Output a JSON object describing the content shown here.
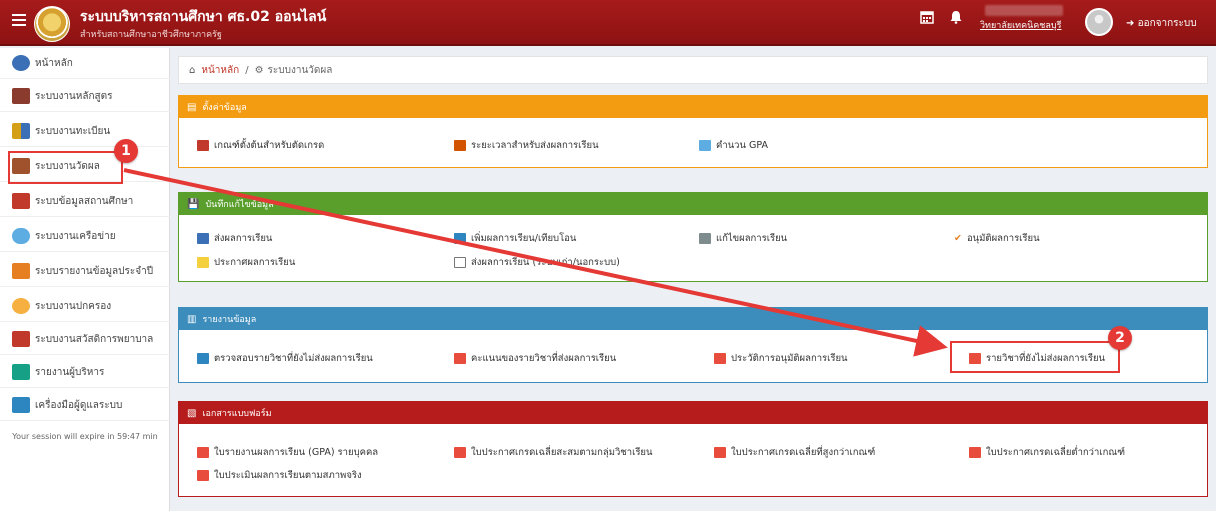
{
  "header": {
    "title": "ระบบบริหารสถานศึกษา ศธ.02 ออนไลน์",
    "subtitle": "สำหรับสถานศึกษาอาชีวศึกษาภาครัฐ",
    "school": "วิทยาลัยเทคนิคชลบุรี",
    "logout_label": "ออกจากระบบ",
    "calendar_icon": "calendar-icon",
    "bell_icon": "bell-icon"
  },
  "sidebar": {
    "items": [
      {
        "label": "หน้าหลัก",
        "icon": "globe-icon",
        "color": "#3b6fb6"
      },
      {
        "label": "ระบบงานหลักสูตร",
        "icon": "book-icon",
        "color": "#8b3a2e"
      },
      {
        "label": "ระบบงานทะเบียน",
        "icon": "people-icon",
        "color": "#d4a017"
      },
      {
        "label": "ระบบงานวัดผล",
        "icon": "calculator-icon",
        "color": "#a0522d"
      },
      {
        "label": "ระบบข้อมูลสถานศึกษา",
        "icon": "school-icon",
        "color": "#c0392b"
      },
      {
        "label": "ระบบงานเครือข่าย",
        "icon": "cloud-icon",
        "color": "#5dade2"
      },
      {
        "label": "ระบบรายงานข้อมูลประจำปี",
        "icon": "report-icon",
        "color": "#e67e22"
      },
      {
        "label": "ระบบงานปกครอง",
        "icon": "person-icon",
        "color": "#f5b041"
      },
      {
        "label": "ระบบงานสวัสดิการพยาบาล",
        "icon": "first-aid-icon",
        "color": "#c0392b"
      },
      {
        "label": "รายงานผู้บริหาร",
        "icon": "chart-icon",
        "color": "#16a085"
      },
      {
        "label": "เครื่องมือผู้ดูแลระบบ",
        "icon": "admin-icon",
        "color": "#2e86c1"
      }
    ],
    "session": "Your session will expire in 59:47 min"
  },
  "breadcrumb": {
    "home": "หน้าหลัก",
    "sep": "/",
    "current": "ระบบงานวัดผล"
  },
  "panels": {
    "settings": {
      "title": "ตั้งค่าข้อมูล",
      "color": "#f39c12",
      "items": [
        "เกณฑ์ตั้งต้นสำหรับตัดเกรด",
        "ระยะเวลาสำหรับส่งผลการเรียน",
        "คำนวน GPA"
      ]
    },
    "record": {
      "title": "บันทึกแก้ไขข้อมูล",
      "color": "#5a9e2c",
      "items": [
        "ส่งผลการเรียน",
        "เพิ่มผลการเรียน/เทียบโอน",
        "แก้ไขผลการเรียน",
        "อนุมัติผลการเรียน",
        "ประกาศผลการเรียน",
        "ส่งผลการเรียน (ระบบเก่า/นอกระบบ)"
      ]
    },
    "reports": {
      "title": "รายงานข้อมูล",
      "color": "#3c8dbc",
      "items": [
        "ตรวจสอบรายวิชาที่ยังไม่ส่งผลการเรียน",
        "คะแนนของรายวิชาที่ส่งผลการเรียน",
        "ประวัติการอนุมัติผลการเรียน",
        "รายวิชาที่ยังไม่ส่งผลการเรียน"
      ]
    },
    "forms": {
      "title": "เอกสารแบบฟอร์ม",
      "color": "#b71c1c",
      "items": [
        "ใบรายงานผลการเรียน (GPA) รายบุคคล",
        "ใบประกาศเกรดเฉลี่ยสะสมตามกลุ่มวิชาเรียน",
        "ใบประกาศเกรดเฉลี่ยที่สูงกว่าเกณฑ์",
        "ใบประกาศเกรดเฉลี่ยต่ำกว่าเกณฑ์",
        "ใบประเมินผลการเรียนตามสภาพจริง"
      ]
    }
  },
  "annotations": {
    "badge1": "1",
    "badge2": "2"
  }
}
